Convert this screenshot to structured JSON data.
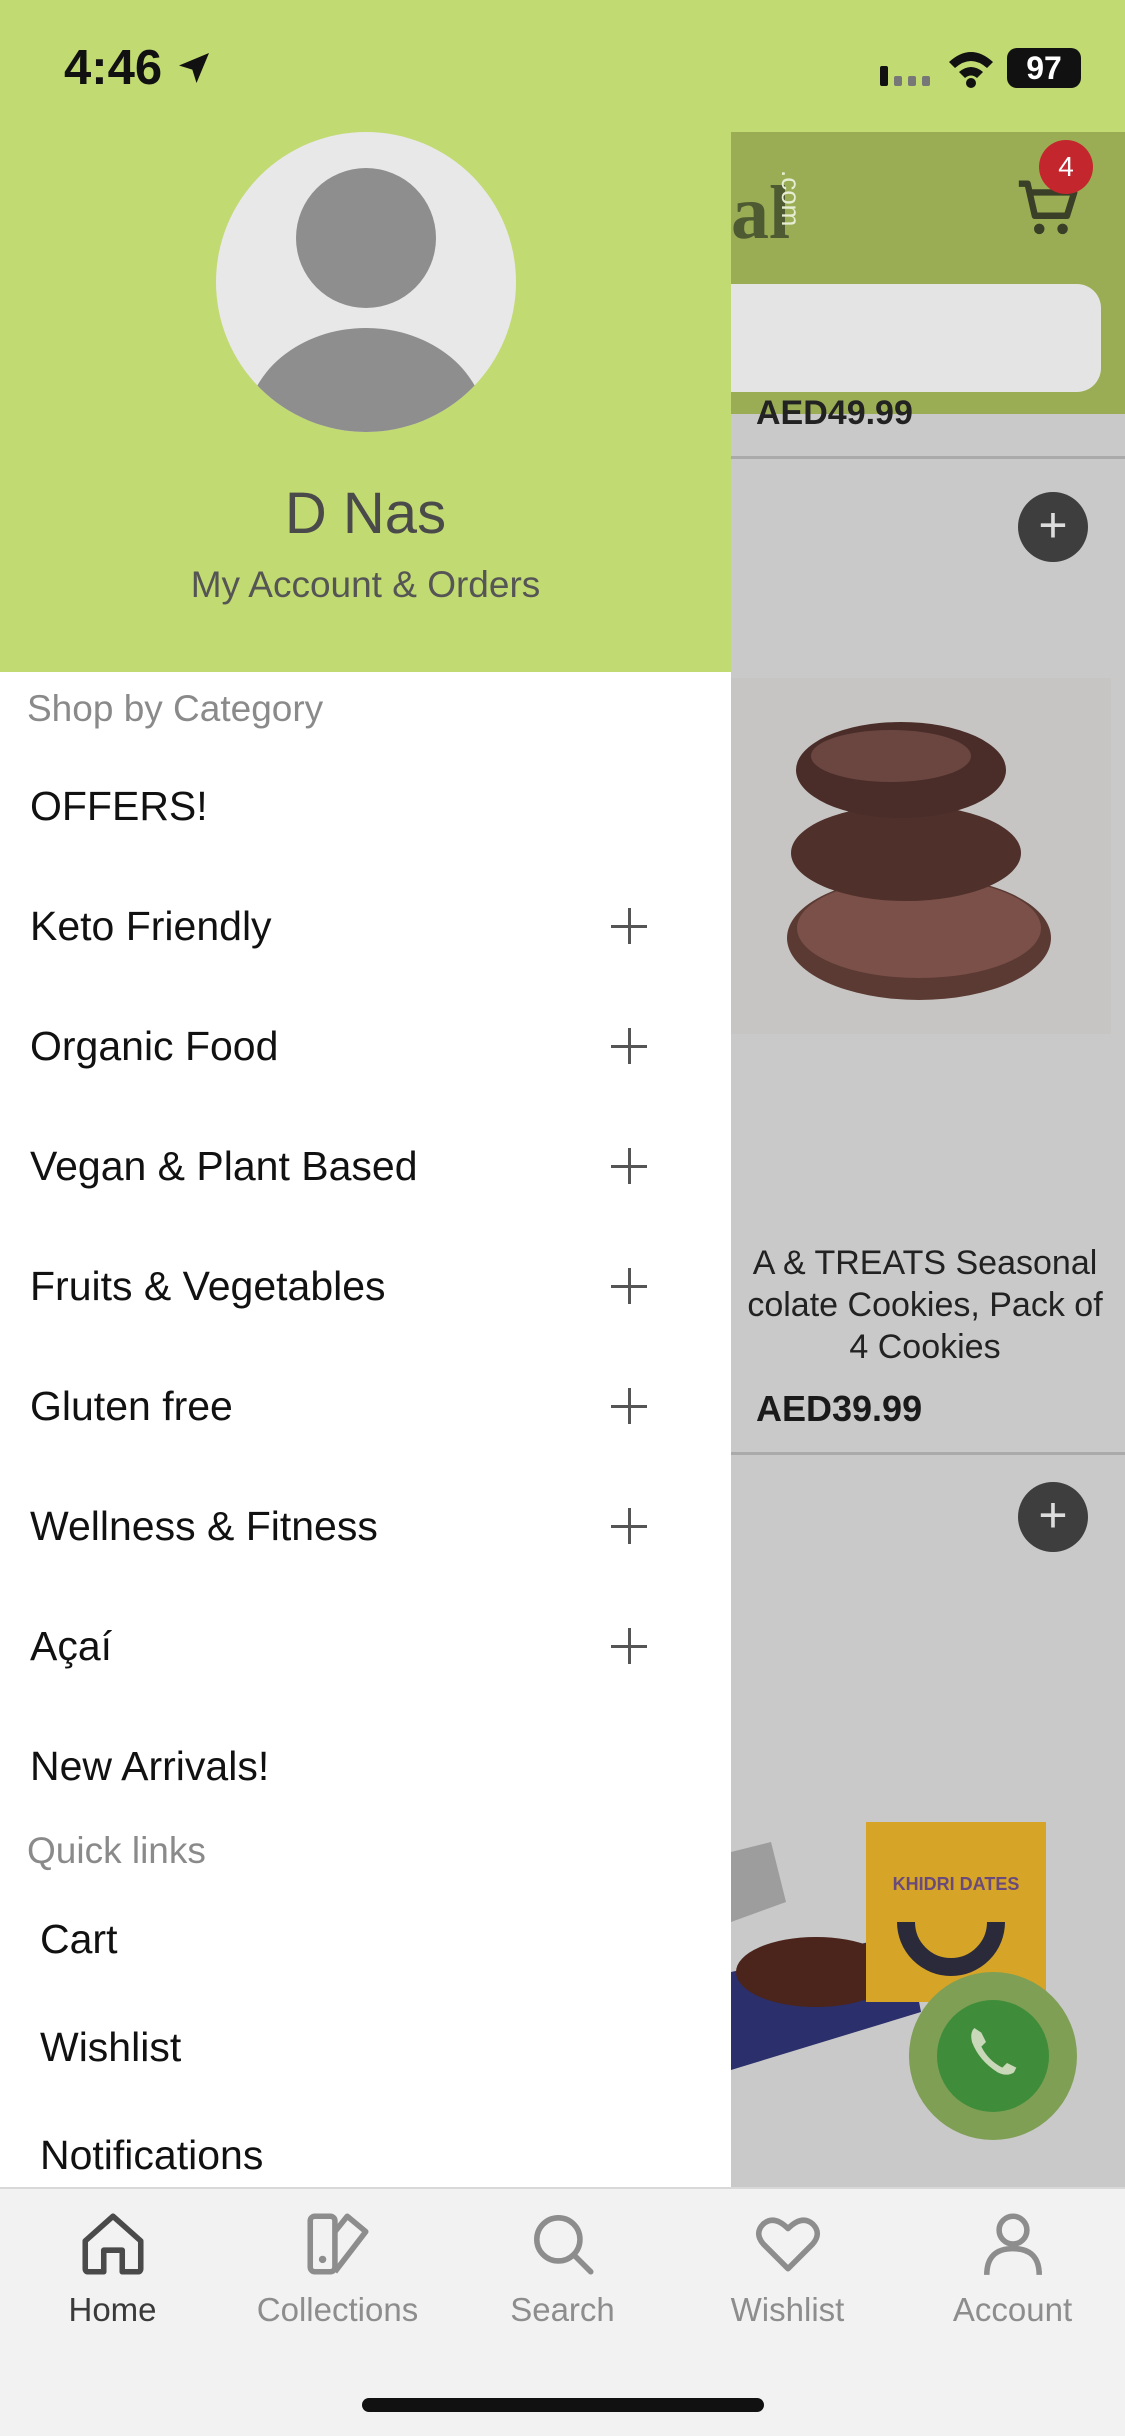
{
  "status_bar": {
    "time": "4:46",
    "battery": "97",
    "icons": [
      "location-arrow-icon",
      "signal-icon",
      "wifi-icon",
      "battery-icon"
    ]
  },
  "drawer": {
    "user_name": "D Nas",
    "account_link": "My Account & Orders",
    "shop_by_category_title": "Shop by Category",
    "categories": [
      {
        "label": "OFFERS!",
        "expandable": false
      },
      {
        "label": "Keto Friendly",
        "expandable": true
      },
      {
        "label": "Organic Food",
        "expandable": true
      },
      {
        "label": "Vegan & Plant Based",
        "expandable": true
      },
      {
        "label": "Fruits & Vegetables",
        "expandable": true
      },
      {
        "label": "Gluten free",
        "expandable": true
      },
      {
        "label": "Wellness & Fitness",
        "expandable": true
      },
      {
        "label": "Açaí",
        "expandable": true
      },
      {
        "label": "New Arrivals!",
        "expandable": false
      }
    ],
    "quick_links_title": "Quick links",
    "quick_links": [
      "Cart",
      "Wishlist",
      "Notifications"
    ]
  },
  "background": {
    "logo_text": "al",
    "logo_suffix": ".com",
    "cart_badge": "4",
    "price_top": "AED49.99",
    "product_title": "A & TREATS Seasonal\ncolate Cookies, Pack of\n4 Cookies",
    "product_price": "AED39.99",
    "dates_box_label": "KHIDRI DATES"
  },
  "tab_bar": {
    "tabs": [
      {
        "label": "Home",
        "icon": "home-icon",
        "active": true
      },
      {
        "label": "Collections",
        "icon": "collections-icon",
        "active": false
      },
      {
        "label": "Search",
        "icon": "search-icon",
        "active": false
      },
      {
        "label": "Wishlist",
        "icon": "heart-icon",
        "active": false
      },
      {
        "label": "Account",
        "icon": "person-icon",
        "active": false
      }
    ]
  },
  "colors": {
    "header_green": "#c1da72",
    "badge_red": "#c4262d",
    "drawer_bg": "#ffffff",
    "tab_active": "#3a3a3a",
    "tab_inactive": "#8d8d8d"
  }
}
